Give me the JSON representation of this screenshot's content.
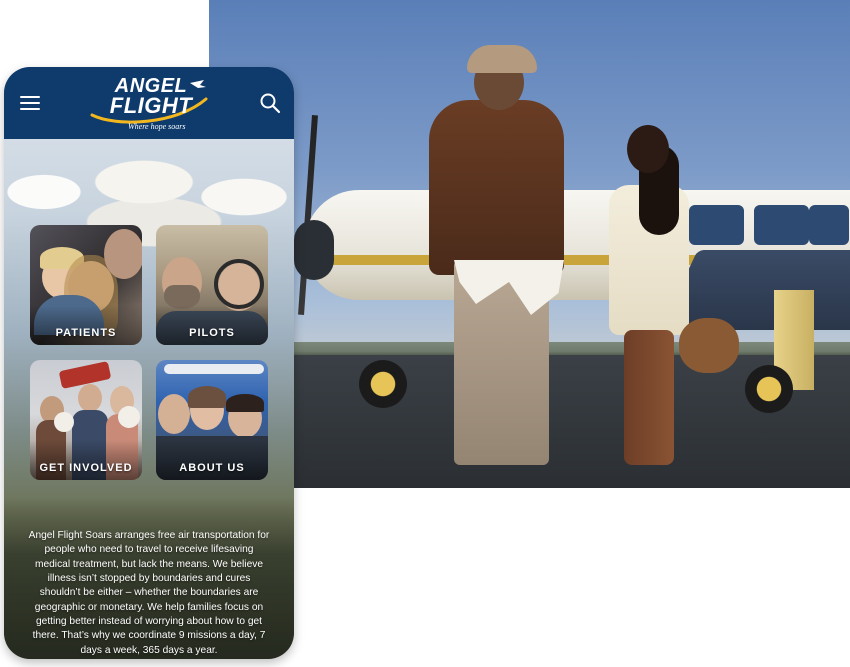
{
  "header": {
    "logo_line1": "ANGEL",
    "logo_line2": "FLIGHT",
    "tagline": "Where hope soars",
    "bg_color": "#0e3a6c",
    "menu_icon": "hamburger-menu-icon",
    "search_icon": "search-icon"
  },
  "tiles": [
    {
      "label": "PATIENTS"
    },
    {
      "label": "PILOTS"
    },
    {
      "label": "GET INVOLVED"
    },
    {
      "label": "ABOUT US"
    }
  ],
  "description": "Angel Flight Soars arranges free air transportation for people who need to travel to receive lifesaving medical treatment, but lack the means. We believe illness isn’t stopped by boundaries and cures shouldn’t be either – whether the boundaries are geographic or monetary. We help families focus on getting better instead of worrying about how to get there. That’s why we coordinate 9 missions a day, 7 days a week, 365 days a year."
}
